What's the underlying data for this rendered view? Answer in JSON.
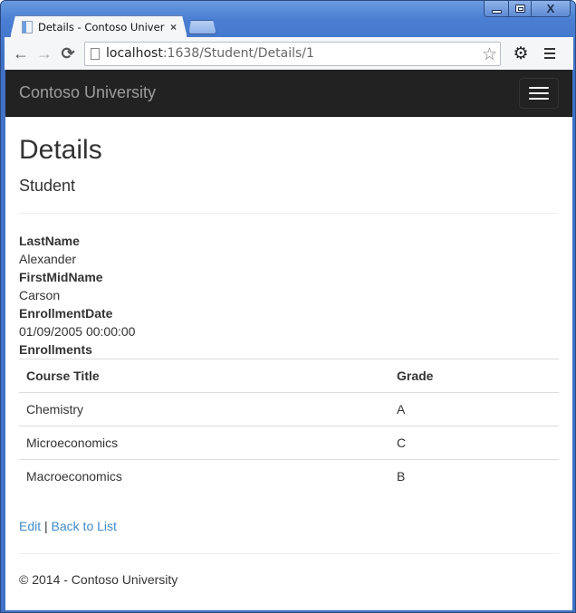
{
  "window": {
    "controls": {
      "minimize": "minimize",
      "maximize": "maximize",
      "close": "close"
    }
  },
  "browser": {
    "tab": {
      "title": "Details - Contoso Universi",
      "favicon": "page-icon",
      "close_icon": "×"
    },
    "nav": {
      "back_icon": "←",
      "forward_icon": "→",
      "reload_icon": "⟳"
    },
    "address": {
      "host": "localhost",
      "path": ":1638/Student/Details/1"
    },
    "star_icon": "☆",
    "settings_icon": "⚙"
  },
  "site": {
    "brand": "Contoso University"
  },
  "page": {
    "title": "Details",
    "subtitle": "Student",
    "fields": [
      {
        "label": "LastName",
        "value": "Alexander"
      },
      {
        "label": "FirstMidName",
        "value": "Carson"
      },
      {
        "label": "EnrollmentDate",
        "value": "01/09/2005 00:00:00"
      }
    ],
    "enrollments_label": "Enrollments",
    "table": {
      "headers": [
        "Course Title",
        "Grade"
      ],
      "rows": [
        [
          "Chemistry",
          "A"
        ],
        [
          "Microeconomics",
          "C"
        ],
        [
          "Macroeconomics",
          "B"
        ]
      ]
    },
    "actions": {
      "edit": "Edit",
      "separator": "|",
      "back": "Back to List"
    },
    "footer": "© 2014 - Contoso University"
  },
  "colors": {
    "navbar_bg": "#222222",
    "brand_text": "#9d9d9d",
    "link": "#428bca",
    "text": "#333333"
  }
}
